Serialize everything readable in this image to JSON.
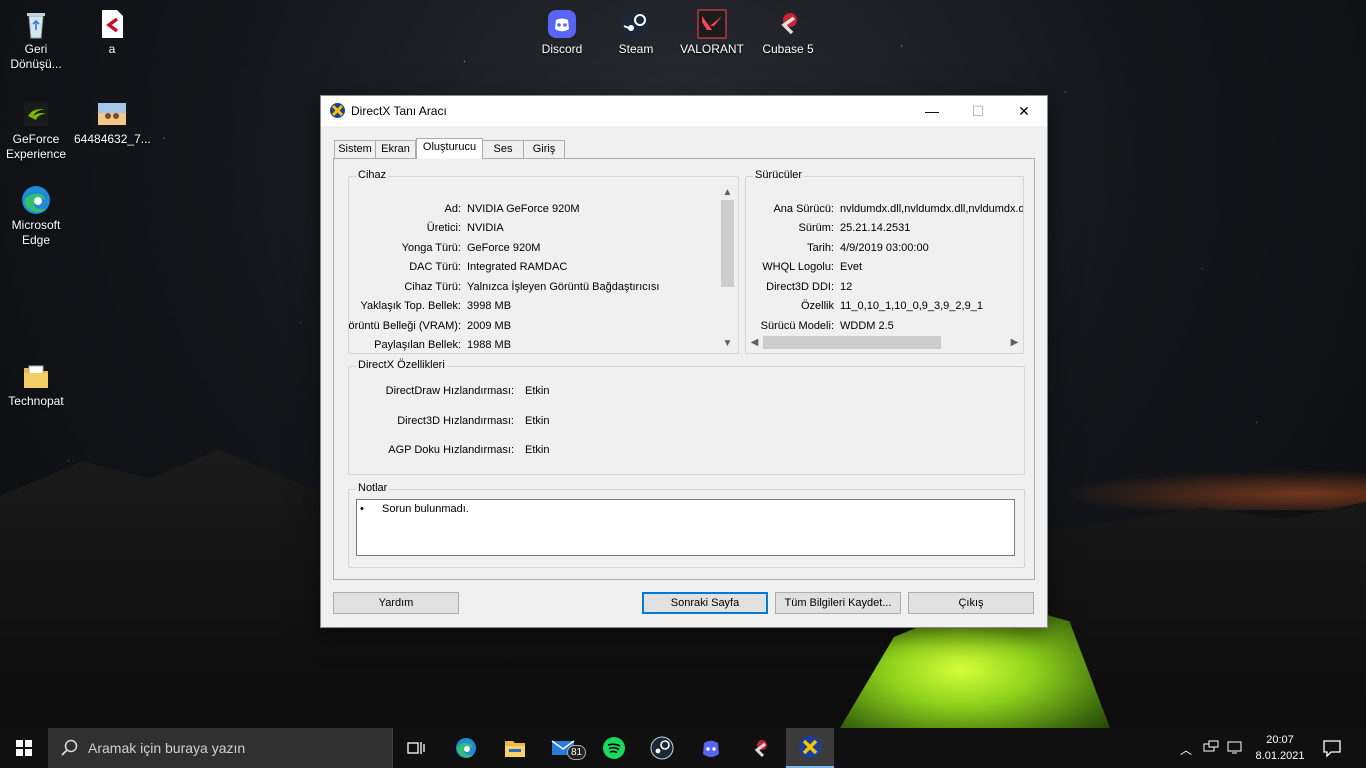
{
  "desktop": {
    "icons": [
      {
        "label": "Geri Dönüşü...",
        "icon": "recycle-bin-icon"
      },
      {
        "label": "a",
        "icon": "cubase-file-icon"
      },
      {
        "label": "GeForce Experience",
        "icon": "nvidia-icon"
      },
      {
        "label": "64484632_7...",
        "icon": "image-file-icon"
      },
      {
        "label": "Microsoft Edge",
        "icon": "edge-icon"
      },
      {
        "label": "Technopat",
        "icon": "folder-icon"
      },
      {
        "label": "Discord",
        "icon": "discord-icon"
      },
      {
        "label": "Steam",
        "icon": "steam-icon"
      },
      {
        "label": "VALORANT",
        "icon": "valorant-icon"
      },
      {
        "label": "Cubase 5",
        "icon": "cubase-icon"
      }
    ]
  },
  "window": {
    "title": "DirectX Tanı Aracı",
    "controls": {
      "minimize": "—",
      "maximize": "☐",
      "close": "✕"
    },
    "tabs": [
      "Sistem",
      "Ekran",
      "Oluşturucu",
      "Ses",
      "Giriş"
    ],
    "active_tab": "Oluşturucu",
    "device": {
      "label": "Cihaz",
      "rows": [
        {
          "key": "Ad:",
          "value": "NVIDIA GeForce 920M"
        },
        {
          "key": "Üretici:",
          "value": "NVIDIA"
        },
        {
          "key": "Yonga Türü:",
          "value": "GeForce 920M"
        },
        {
          "key": "DAC Türü:",
          "value": "Integrated RAMDAC"
        },
        {
          "key": "Cihaz Türü:",
          "value": "Yalnızca İşleyen Görüntü Bağdaştırıcısı"
        },
        {
          "key": "Yaklaşık Top. Bellek:",
          "value": "3998 MB"
        },
        {
          "key": "Görüntü Belleği (VRAM):",
          "value": "2009 MB"
        },
        {
          "key": "Paylaşılan Bellek:",
          "value": "1988 MB"
        }
      ]
    },
    "drivers": {
      "label": "Sürücüler",
      "rows": [
        {
          "key": "Ana Sürücü:",
          "value": "nvldumdx.dll,nvldumdx.dll,nvldumdx.d"
        },
        {
          "key": "Sürüm:",
          "value": "25.21.14.2531"
        },
        {
          "key": "Tarih:",
          "value": "4/9/2019 03:00:00"
        },
        {
          "key": "WHQL Logolu:",
          "value": "Evet"
        },
        {
          "key": "Direct3D DDI:",
          "value": "12"
        },
        {
          "key": "Özellik",
          "value": "11_0,10_1,10_0,9_3,9_2,9_1"
        },
        {
          "key": "Sürücü Modeli:",
          "value": "WDDM 2.5"
        }
      ]
    },
    "features": {
      "label": "DirectX Özellikleri",
      "rows": [
        {
          "key": "DirectDraw Hızlandırması:",
          "value": "Etkin"
        },
        {
          "key": "Direct3D Hızlandırması:",
          "value": "Etkin"
        },
        {
          "key": "AGP Doku Hızlandırması:",
          "value": "Etkin"
        }
      ]
    },
    "notes": {
      "label": "Notlar",
      "bullet": "•",
      "text": "Sorun bulunmadı."
    },
    "buttons": {
      "help": "Yardım",
      "next": "Sonraki Sayfa",
      "save": "Tüm Bilgileri Kaydet...",
      "exit": "Çıkış"
    }
  },
  "taskbar": {
    "search_placeholder": "Aramak için buraya yazın",
    "mail_badge": "81",
    "time": "20:07",
    "date": "8.01.2021",
    "pinned": [
      "task-view-icon",
      "edge-icon",
      "file-explorer-icon",
      "mail-icon",
      "spotify-icon",
      "steam-icon",
      "discord-icon",
      "cubase-icon",
      "directx-icon"
    ]
  }
}
